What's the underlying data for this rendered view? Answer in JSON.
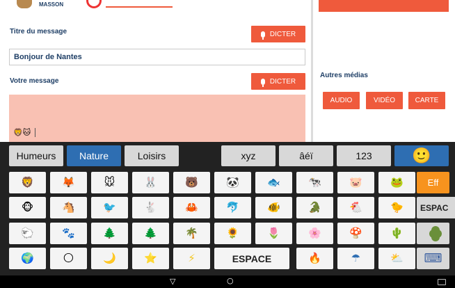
{
  "user": {
    "name": "MASSON"
  },
  "form": {
    "title_label": "Titre du message",
    "title_value": "Bonjour de Nantes",
    "message_label": "Votre message",
    "dictate_label": "DICTER",
    "message_content": "🦁🐱"
  },
  "media": {
    "label": "Autres médias",
    "audio": "AUDIO",
    "video": "VIDÉO",
    "map": "CARTE"
  },
  "keyboard": {
    "tabs": {
      "moods": "Humeurs",
      "nature": "Nature",
      "leisure": "Loisirs",
      "xyz": "xyz",
      "accents": "âéï",
      "numbers": "123",
      "emoji": "🙂"
    },
    "rows": [
      [
        "🦁",
        "🦊",
        "🐭",
        "🐰",
        "🐻",
        "🐼",
        "🐟",
        "🐄",
        "🐷",
        "🐸"
      ],
      [
        "🐵",
        "🐴",
        "🐦",
        "🐇",
        "🦀",
        "🐬",
        "🐠",
        "🐊",
        "🐔",
        "🐤"
      ],
      [
        "🐑",
        "🐾",
        "🌲",
        "🌲",
        "🌴",
        "🌻",
        "🌷",
        "🌸",
        "🍄",
        "🌵"
      ],
      [
        "🌍",
        "🌕",
        "🌙",
        "⭐",
        "⚡",
        "",
        "",
        "🔥",
        "☂",
        "⛅"
      ]
    ],
    "space": "ESPACE",
    "delete": "Eff",
    "side_space": "ESPAC",
    "keyboard_icon": "⌨"
  },
  "navbar": {
    "back": "▽",
    "home": "○"
  },
  "colors": {
    "accent": "#ef5a3c",
    "keyboard_bg": "#222222",
    "active_tab": "#2e6eb2",
    "message_bg": "#f9c1b3"
  }
}
